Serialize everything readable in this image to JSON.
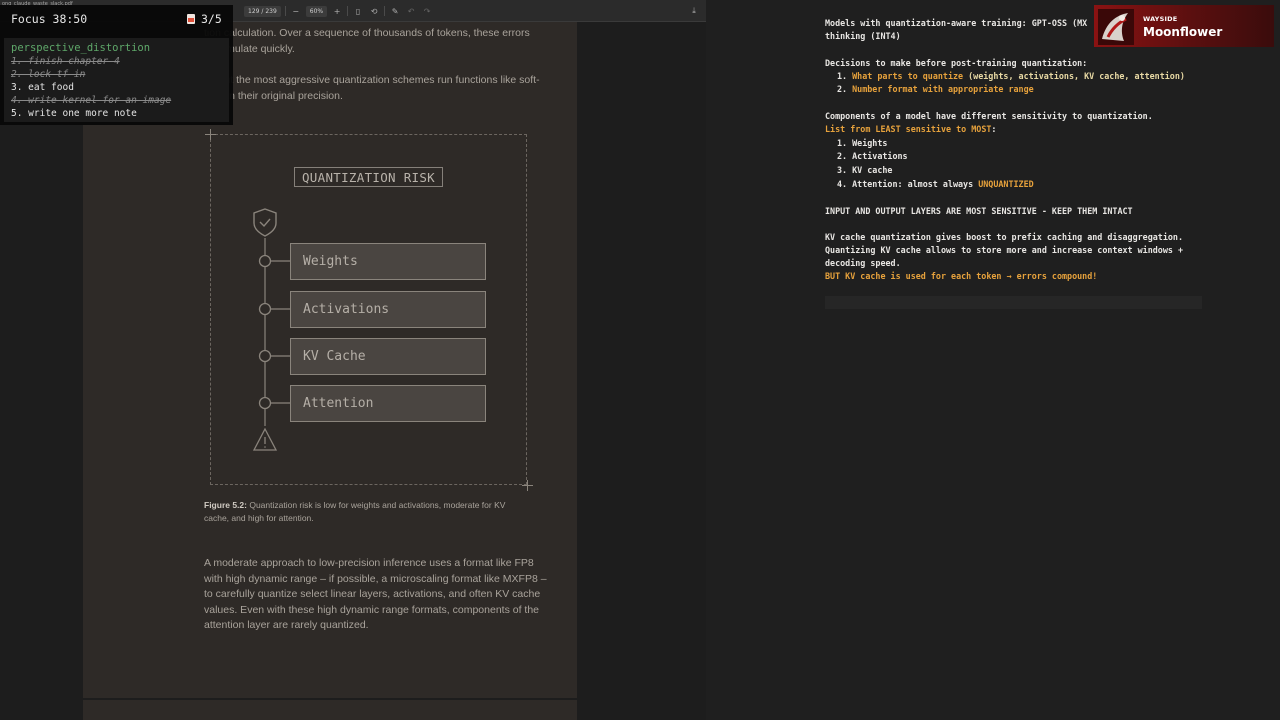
{
  "viewer": {
    "filename": "ong_claude_waste_slack.pdf",
    "page_current": "129",
    "page_separator": "/",
    "page_total": "239",
    "zoom": "60%",
    "zoom_out": "−",
    "zoom_in": "+"
  },
  "pdf": {
    "para_top_1": "tion calculation. Over a sequence of thousands of tokens, these errors",
    "para_top_2": "accumulate quickly.",
    "para_2_1": "All but the most aggressive quantization schemes run functions like soft-",
    "para_2_2": "max in their original precision.",
    "figure": {
      "title": "QUANTIZATION RISK",
      "items": [
        "Weights",
        "Activations",
        "KV Cache",
        "Attention"
      ]
    },
    "caption_label": "Figure 5.2:",
    "caption_text": " Quantization risk is low for weights and activations, moderate for KV cache, and high for attention.",
    "para_3": [
      "A moderate approach to low-precision inference uses a format like FP8",
      "with high dynamic range – if possible, a microscaling format like MXFP8 –",
      "to carefully quantize select linear layers, activations, and often KV cache",
      "values. Even with these high dynamic range formats, components of the",
      "attention layer are rarely quantized."
    ]
  },
  "focus": {
    "timer": "Focus 38:50",
    "count": "3/5",
    "heading": "perspective_distortion",
    "items": [
      {
        "text": "1. finish chapter 4",
        "done": true
      },
      {
        "text": "2. lock tf in",
        "done": true
      },
      {
        "text": "3. eat food",
        "done": false
      },
      {
        "text": "4. write kernel for an image",
        "done": true
      },
      {
        "text": "5. write one more note",
        "done": false
      }
    ]
  },
  "notes": {
    "line1": "Models with quantization-aware training: GPT-OSS (MX",
    "line2": "thinking (INT4)",
    "decisions_title": "Decisions to make before post-training quantization:",
    "decision1_num": "1. ",
    "decision1_hl": "What parts to quantize",
    "decision1_rest": " (weights, activations, KV cache, attention)",
    "decision2_num": "2. ",
    "decision2_hl": "Number format with appropriate range",
    "components_title": "Components of a model have different sensitivity to quantization.",
    "list_pre": "List from ",
    "list_least": "LEAST sensitive",
    "list_mid": " to ",
    "list_most": "MOST",
    "list_post": ":",
    "comp1": "1. Weights",
    "comp2": "2. Activations",
    "comp3": "3. KV cache",
    "comp4_pre": "4. Attention: almost always ",
    "comp4_hl": "UNQUANTIZED",
    "io_layers": "INPUT AND OUTPUT LAYERS ARE MOST SENSITIVE - KEEP THEM INTACT",
    "kv1": "KV cache quantization gives boost to prefix caching and disaggregation.",
    "kv2": "Quantizing KV cache allows to store more and increase context windows +",
    "kv3": "decoding speed.",
    "kv4": "BUT KV cache is used for each token → errors compound!"
  },
  "badge": {
    "label": "WAYSIDE",
    "name": "Moonflower"
  },
  "colors": {
    "accent_orange": "#e7a23c",
    "todo_heading_green": "#5fa86a",
    "badge_red": "#8a1212"
  }
}
